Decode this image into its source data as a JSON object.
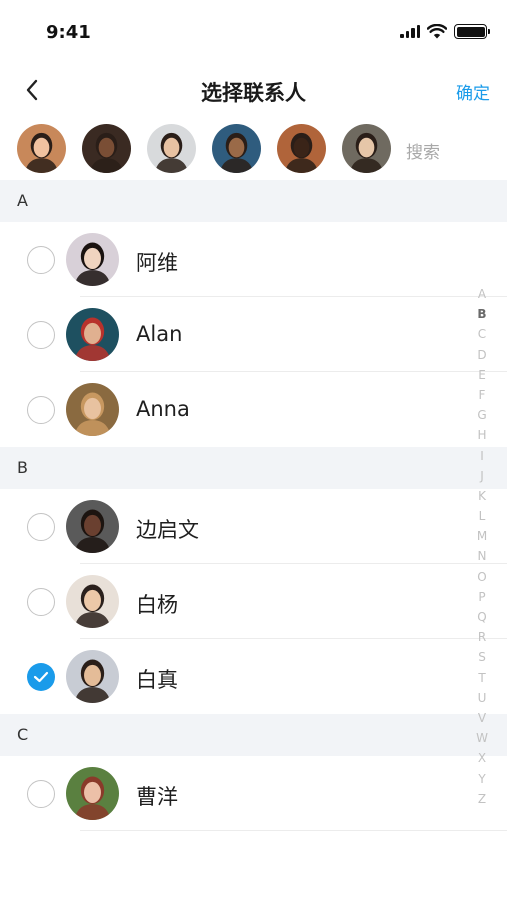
{
  "status": {
    "time": "9:41"
  },
  "nav": {
    "title": "选择联系人",
    "confirm": "确定"
  },
  "selected": {
    "avatars": [
      {
        "name": "selected-avatar-1",
        "bg": "#c8885a",
        "face": "#f0c2a0"
      },
      {
        "name": "selected-avatar-2",
        "bg": "#3a2a22",
        "face": "#7a4e35"
      },
      {
        "name": "selected-avatar-3",
        "bg": "#d8dadc",
        "face": "#e8c2a2"
      },
      {
        "name": "selected-avatar-4",
        "bg": "#2f5c7e",
        "face": "#9a6a48"
      },
      {
        "name": "selected-avatar-5",
        "bg": "#b0643a",
        "face": "#3a2418"
      },
      {
        "name": "selected-avatar-6",
        "bg": "#6f6a60",
        "face": "#e6c6a8"
      }
    ],
    "search_placeholder": "搜索"
  },
  "sections": [
    {
      "letter": "A",
      "contacts": [
        {
          "name": "阿维",
          "checked": false,
          "bg": "#d8d0d8",
          "face": "#f0d4c0",
          "hair": "#1a1210"
        },
        {
          "name": "Alan",
          "checked": false,
          "bg": "#1e5060",
          "face": "#e0b090",
          "hair": "#b8322c"
        },
        {
          "name": "Anna",
          "checked": false,
          "bg": "#8a6a40",
          "face": "#e8c2a0",
          "hair": "#c89860"
        }
      ]
    },
    {
      "letter": "B",
      "contacts": [
        {
          "name": "边启文",
          "checked": false,
          "bg": "#5a5a5a",
          "face": "#6a4030",
          "hair": "#1c1410"
        },
        {
          "name": "白杨",
          "checked": false,
          "bg": "#e8e0d8",
          "face": "#ecc8a8",
          "hair": "#2a201c"
        },
        {
          "name": "白真",
          "checked": true,
          "bg": "#c8ccd4",
          "face": "#e4bc98",
          "hair": "#2a1e18"
        }
      ]
    },
    {
      "letter": "C",
      "contacts": [
        {
          "name": "曹洋",
          "checked": false,
          "bg": "#5a8040",
          "face": "#ecc0a8",
          "hair": "#8a3a2a"
        }
      ]
    }
  ],
  "index_letters": [
    "A",
    "B",
    "C",
    "D",
    "E",
    "F",
    "G",
    "H",
    "I",
    "J",
    "K",
    "L",
    "M",
    "N",
    "O",
    "P",
    "Q",
    "R",
    "S",
    "T",
    "U",
    "V",
    "W",
    "X",
    "Y",
    "Z"
  ],
  "index_active": "B",
  "colors": {
    "accent": "#1a9bea",
    "section_bg": "#f2f4f7"
  }
}
